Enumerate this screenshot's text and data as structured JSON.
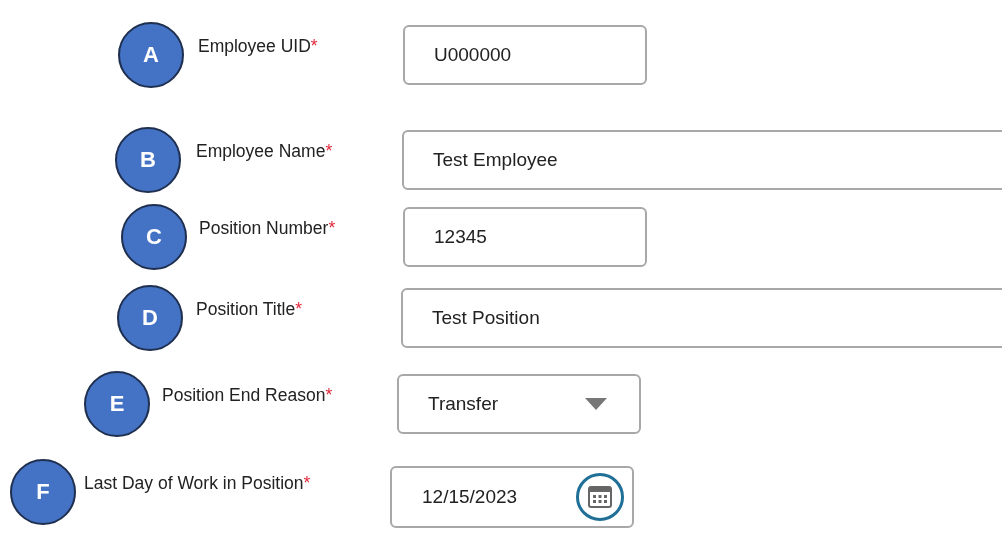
{
  "fields": [
    {
      "marker": "A",
      "label": "Employee UID",
      "required_mark": "*",
      "kind": "text",
      "value": "U000000"
    },
    {
      "marker": "B",
      "label": "Employee Name",
      "required_mark": "*",
      "kind": "text",
      "value": "Test Employee"
    },
    {
      "marker": "C",
      "label": "Position Number",
      "required_mark": "*",
      "kind": "text",
      "value": "12345"
    },
    {
      "marker": "D",
      "label": "Position Title",
      "required_mark": "*",
      "kind": "text",
      "value": "Test Position"
    },
    {
      "marker": "E",
      "label": "Position End Reason",
      "required_mark": "*",
      "kind": "select",
      "value": "Transfer"
    },
    {
      "marker": "F",
      "label": "Last Day of Work in Position",
      "required_mark": "*",
      "kind": "date",
      "value": "12/15/2023"
    }
  ]
}
